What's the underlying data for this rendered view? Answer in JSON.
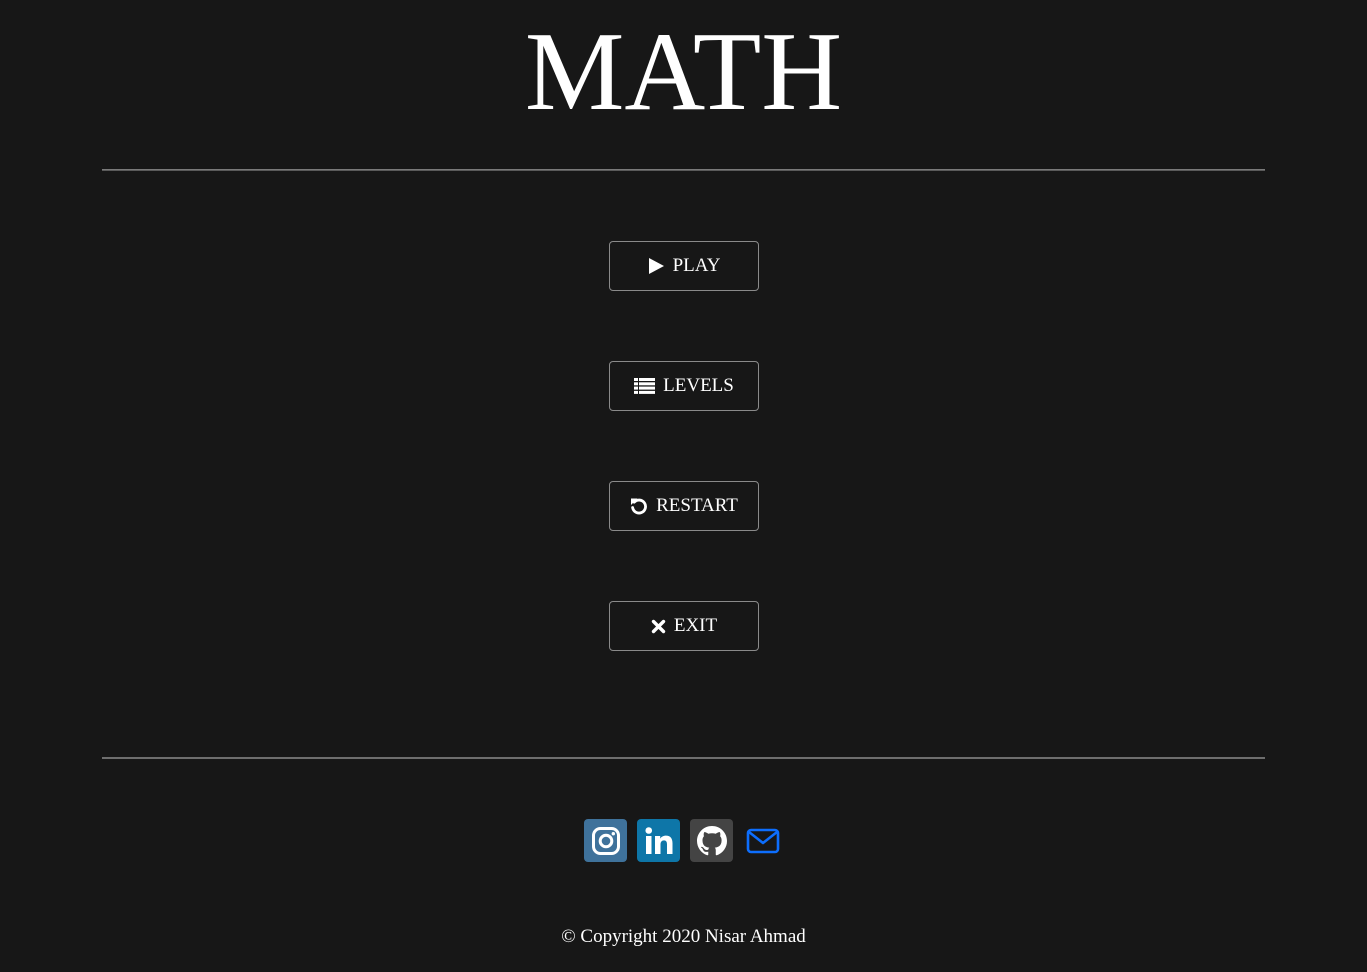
{
  "header": {
    "title": "MATH"
  },
  "menu": {
    "play_label": "PLAY",
    "levels_label": "LEVELS",
    "restart_label": "RESTART",
    "exit_label": "EXIT",
    "icons": [
      "play-icon",
      "list-icon",
      "restart-icon",
      "close-icon"
    ]
  },
  "social": {
    "icons": [
      "instagram-icon",
      "linkedin-icon",
      "github-icon",
      "mail-icon"
    ],
    "colors": {
      "instagram": "#3f729b",
      "linkedin": "#0e76a8",
      "github": "#444444",
      "mail": "#0d6efd"
    }
  },
  "footer": {
    "copyright": "© Copyright 2020 Nisar Ahmad"
  },
  "theme": {
    "background": "#171717",
    "text": "#ffffff",
    "button_border": "#8a8a8a"
  }
}
